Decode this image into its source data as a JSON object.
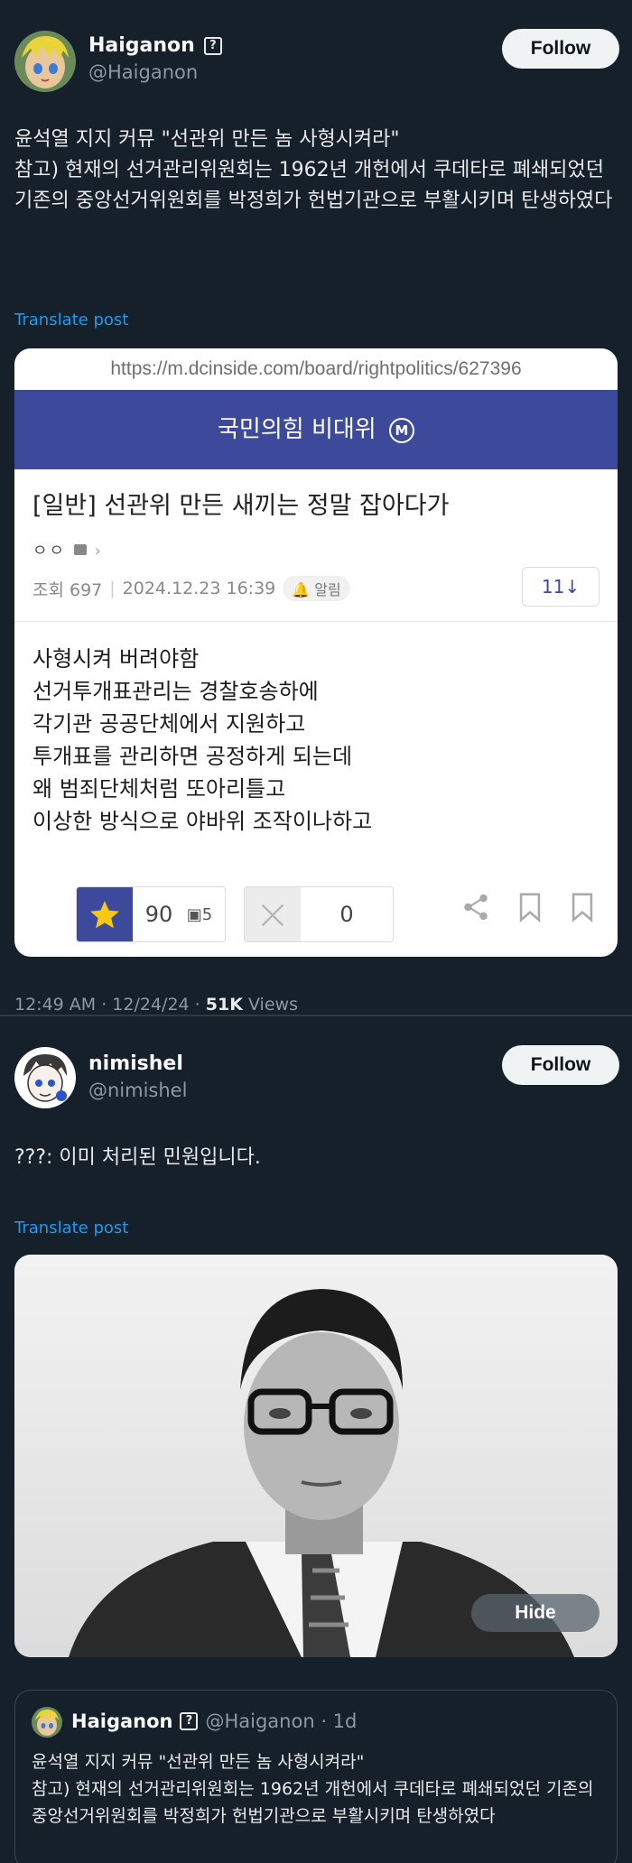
{
  "post1": {
    "author": {
      "name": "Haiganon",
      "handle": "@Haiganon"
    },
    "verified_glyph": "?",
    "follow_label": "Follow",
    "text": "윤석열 지지 커뮤 \"선관위 만든 놈 사형시켜라\"\n참고) 현재의 선거관리위원회는 1962년 개헌에서 쿠데타로 폐쇄되었던 기존의 중앙선거위원회를 박정희가 헌법기관으로 부활시키며 탄생하였다",
    "translate_label": "Translate post",
    "card": {
      "url": "https://m.dcinside.com/board/rightpolitics/627396",
      "banner": "국민의힘 비대위",
      "banner_badge": "M",
      "title": "[일반] 선관위 만든 새끼는 정말 잡아다가",
      "author_dots": "ㅇㅇ",
      "views": "조회 697",
      "date": "2024.12.23 16:39",
      "alarm": "알림",
      "comment_count": "11↓",
      "body": "사형시켜 버려야함\n선거투개표관리는 경찰호송하에\n각기관 공공단체에서 지원하고\n투개표를 관리하면 공정하게 되는데\n왜 범죄단체처럼 또아리틀고\n이상한 방식으로 야바위  조작이나하고",
      "recommend": "90",
      "recommend_sub": "5",
      "downvote": "0"
    },
    "timestamp": "12:49 AM · 12/24/24 · ",
    "views_count": "51K",
    "views_label": " Views"
  },
  "post2": {
    "author": {
      "name": "nimishel",
      "handle": "@nimishel"
    },
    "follow_label": "Follow",
    "text": "???: 이미 처리된 민원입니다.",
    "translate_label": "Translate post",
    "hide_label": "Hide",
    "quote": {
      "name": "Haiganon",
      "verified_glyph": "?",
      "handle_time": "@Haiganon · 1d",
      "text": "윤석열 지지 커뮤 \"선관위 만든 놈 사형시켜라\"\n참고) 현재의 선거관리위원회는 1962년 개헌에서 쿠데타로 폐쇄되었던 기존의 중앙선거위원회를 박정희가 헌법기관으로 부활시키며 탄생하였다"
    }
  },
  "colors": {
    "background": "#15202b",
    "link": "#1d9bf0",
    "dc_brand": "#3d4a9c"
  }
}
